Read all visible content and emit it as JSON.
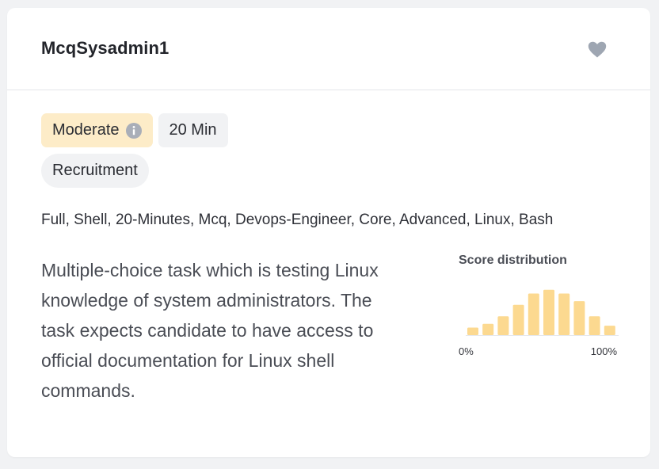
{
  "task": {
    "title": "McqSysadmin1",
    "favorite_icon": "heart-icon",
    "difficulty": "Moderate",
    "duration": "20 Min",
    "category": "Recruitment",
    "tags": "Full, Shell, 20-Minutes, Mcq, Devops-Engineer, Core, Advanced, Linux, Bash",
    "description": "Multiple-choice task which is testing Linux knowledge of system administrators. The task expects candidate to have access to official documentation for Linux shell commands."
  },
  "colors": {
    "difficulty_bg": "#fdecc8",
    "bar_color": "#fcd990",
    "heart_color": "#9ea6b2"
  },
  "chart_data": {
    "type": "bar",
    "title": "Score distribution",
    "x_min_label": "0%",
    "x_max_label": "100%",
    "values": [
      2,
      3,
      5,
      8,
      11,
      12,
      11,
      9,
      5,
      2.5
    ],
    "ylim": [
      0,
      13
    ]
  }
}
